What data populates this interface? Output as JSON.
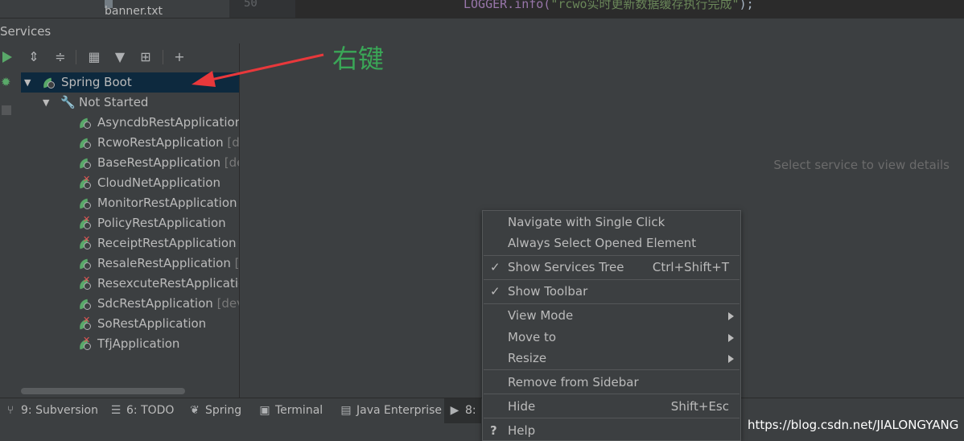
{
  "top_strip": {
    "file_name": "banner.txt",
    "line_number": "50",
    "code_keyword": "LOGGER.info(",
    "code_string": "\"rcwo实时更新数据缓存执行完成\"",
    "code_end": ");"
  },
  "services": {
    "title": "Services",
    "placeholder": "Select service to view details"
  },
  "tree": {
    "root": "Spring Boot",
    "group": "Not Started",
    "items": [
      {
        "name": "AsyncdbRestApplication",
        "suffix": "",
        "failed": false
      },
      {
        "name": "RcwoRestApplication",
        "suffix": "[d",
        "failed": false
      },
      {
        "name": "BaseRestApplication",
        "suffix": "[de",
        "failed": false
      },
      {
        "name": "CloudNetApplication",
        "suffix": "",
        "failed": true
      },
      {
        "name": "MonitorRestApplication",
        "suffix": "",
        "failed": false
      },
      {
        "name": "PolicyRestApplication",
        "suffix": "",
        "failed": true
      },
      {
        "name": "ReceiptRestApplication",
        "suffix": "",
        "failed": true
      },
      {
        "name": "ResaleRestApplication",
        "suffix": "[c",
        "failed": false
      },
      {
        "name": "ResexcuteRestApplicatic",
        "suffix": "",
        "failed": true
      },
      {
        "name": "SdcRestApplication",
        "suffix": "[dev",
        "failed": false
      },
      {
        "name": "SoRestApplication",
        "suffix": "",
        "failed": true
      },
      {
        "name": "TfjApplication",
        "suffix": "",
        "failed": true
      }
    ]
  },
  "annotation": "右键",
  "context_menu": {
    "items": [
      {
        "label": "Navigate with Single Click",
        "shortcut": "",
        "checked": false,
        "submenu": false
      },
      {
        "label": "Always Select Opened Element",
        "shortcut": "",
        "checked": false,
        "submenu": false
      },
      {
        "label": "Show Services Tree",
        "shortcut": "Ctrl+Shift+T",
        "checked": true,
        "submenu": false
      },
      {
        "label": "Show Toolbar",
        "shortcut": "",
        "checked": true,
        "submenu": false
      },
      {
        "label": "View Mode",
        "shortcut": "",
        "checked": false,
        "submenu": true
      },
      {
        "label": "Move to",
        "shortcut": "",
        "checked": false,
        "submenu": true
      },
      {
        "label": "Resize",
        "shortcut": "",
        "checked": false,
        "submenu": true
      },
      {
        "label": "Remove from Sidebar",
        "shortcut": "",
        "checked": false,
        "submenu": false
      },
      {
        "label": "Hide",
        "shortcut": "Shift+Esc",
        "checked": false,
        "submenu": false
      },
      {
        "label": "Help",
        "shortcut": "",
        "checked": false,
        "submenu": false
      }
    ]
  },
  "bottom_tabs": [
    {
      "label": "9: Subversion",
      "icon": "branch-icon"
    },
    {
      "label": "6: TODO",
      "icon": "list-icon"
    },
    {
      "label": "Spring",
      "icon": "spring-leaf-icon"
    },
    {
      "label": "Terminal",
      "icon": "terminal-icon"
    },
    {
      "label": "Java Enterprise",
      "icon": "java-enterprise-icon"
    },
    {
      "label": "8:",
      "icon": "services-icon"
    }
  ],
  "watermark": "https://blog.csdn.net/JIALONGYANG",
  "colors": {
    "accent_green": "#59a869",
    "annotation_green": "#3aa757",
    "annotation_arrow": "#e8383b",
    "selection": "#0d293e",
    "error": "#e05555"
  }
}
